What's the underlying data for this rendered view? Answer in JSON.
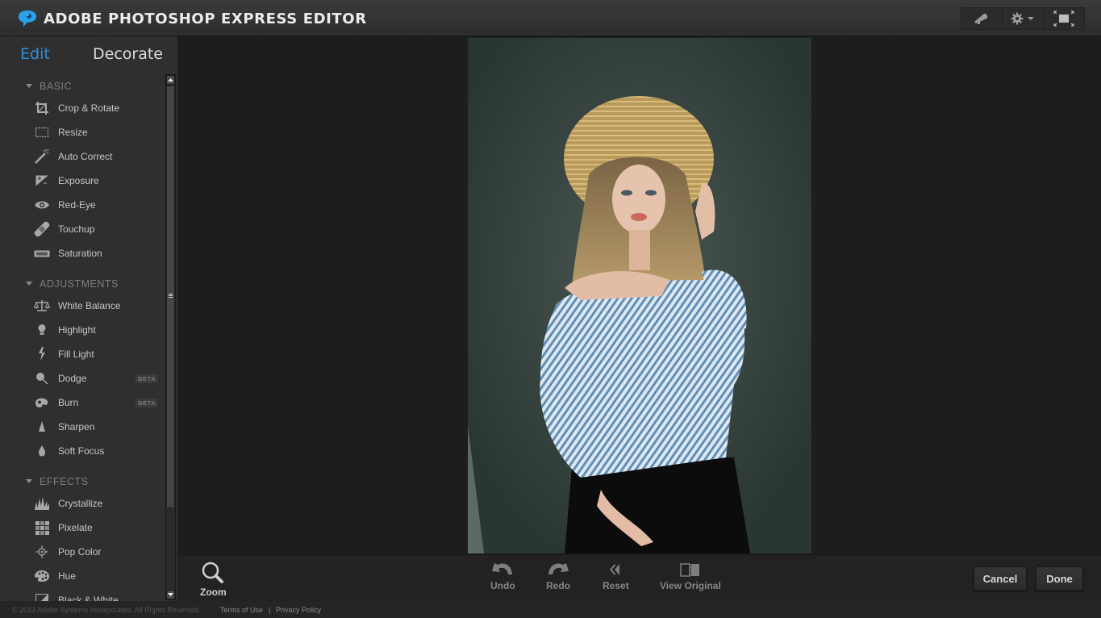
{
  "header": {
    "title": "ADOBE PHOTOSHOP EXPRESS EDITOR",
    "tools": [
      {
        "icon": "megaphone-icon",
        "label": "Announcements"
      },
      {
        "icon": "gear-icon",
        "label": "Settings"
      },
      {
        "icon": "fullscreen-icon",
        "label": "Full Screen"
      }
    ]
  },
  "sidebar": {
    "tabs": [
      {
        "label": "Edit",
        "active": true
      },
      {
        "label": "Decorate",
        "active": false
      }
    ],
    "sections": [
      {
        "title": "BASIC",
        "items": [
          {
            "label": "Crop & Rotate",
            "icon": "crop-icon"
          },
          {
            "label": "Resize",
            "icon": "resize-icon"
          },
          {
            "label": "Auto Correct",
            "icon": "magic-wand-icon"
          },
          {
            "label": "Exposure",
            "icon": "exposure-icon"
          },
          {
            "label": "Red-Eye",
            "icon": "eye-icon"
          },
          {
            "label": "Touchup",
            "icon": "bandage-icon"
          },
          {
            "label": "Saturation",
            "icon": "saturation-icon"
          }
        ]
      },
      {
        "title": "ADJUSTMENTS",
        "items": [
          {
            "label": "White Balance",
            "icon": "scale-icon"
          },
          {
            "label": "Highlight",
            "icon": "lightbulb-icon"
          },
          {
            "label": "Fill Light",
            "icon": "lightning-icon"
          },
          {
            "label": "Dodge",
            "icon": "dodge-icon",
            "badge": "BETA"
          },
          {
            "label": "Burn",
            "icon": "burn-icon",
            "badge": "BETA"
          },
          {
            "label": "Sharpen",
            "icon": "sharpen-icon"
          },
          {
            "label": "Soft Focus",
            "icon": "droplet-icon"
          }
        ]
      },
      {
        "title": "EFFECTS",
        "items": [
          {
            "label": "Crystallize",
            "icon": "crystal-icon"
          },
          {
            "label": "Pixelate",
            "icon": "pixelate-icon"
          },
          {
            "label": "Pop Color",
            "icon": "crosshair-icon"
          },
          {
            "label": "Hue",
            "icon": "palette-icon"
          },
          {
            "label": "Black & White",
            "icon": "black-white-icon"
          }
        ]
      }
    ]
  },
  "canvas": {
    "image_alt": "Woman in straw hat and blue striped shirt"
  },
  "bottombar": {
    "zoom": "Zoom",
    "undo": "Undo",
    "redo": "Redo",
    "reset": "Reset",
    "view_original": "View Original",
    "cancel": "Cancel",
    "done": "Done"
  },
  "footer": {
    "copyright": "© 2013 Adobe Systems Incorporated. All Rights Reserved.",
    "terms": "Terms of Use",
    "separator": "|",
    "privacy": "Privacy Policy"
  },
  "colors": {
    "accent": "#2d8fdb",
    "background": "#1c1c1c",
    "sidebar": "#2f2f2f"
  }
}
